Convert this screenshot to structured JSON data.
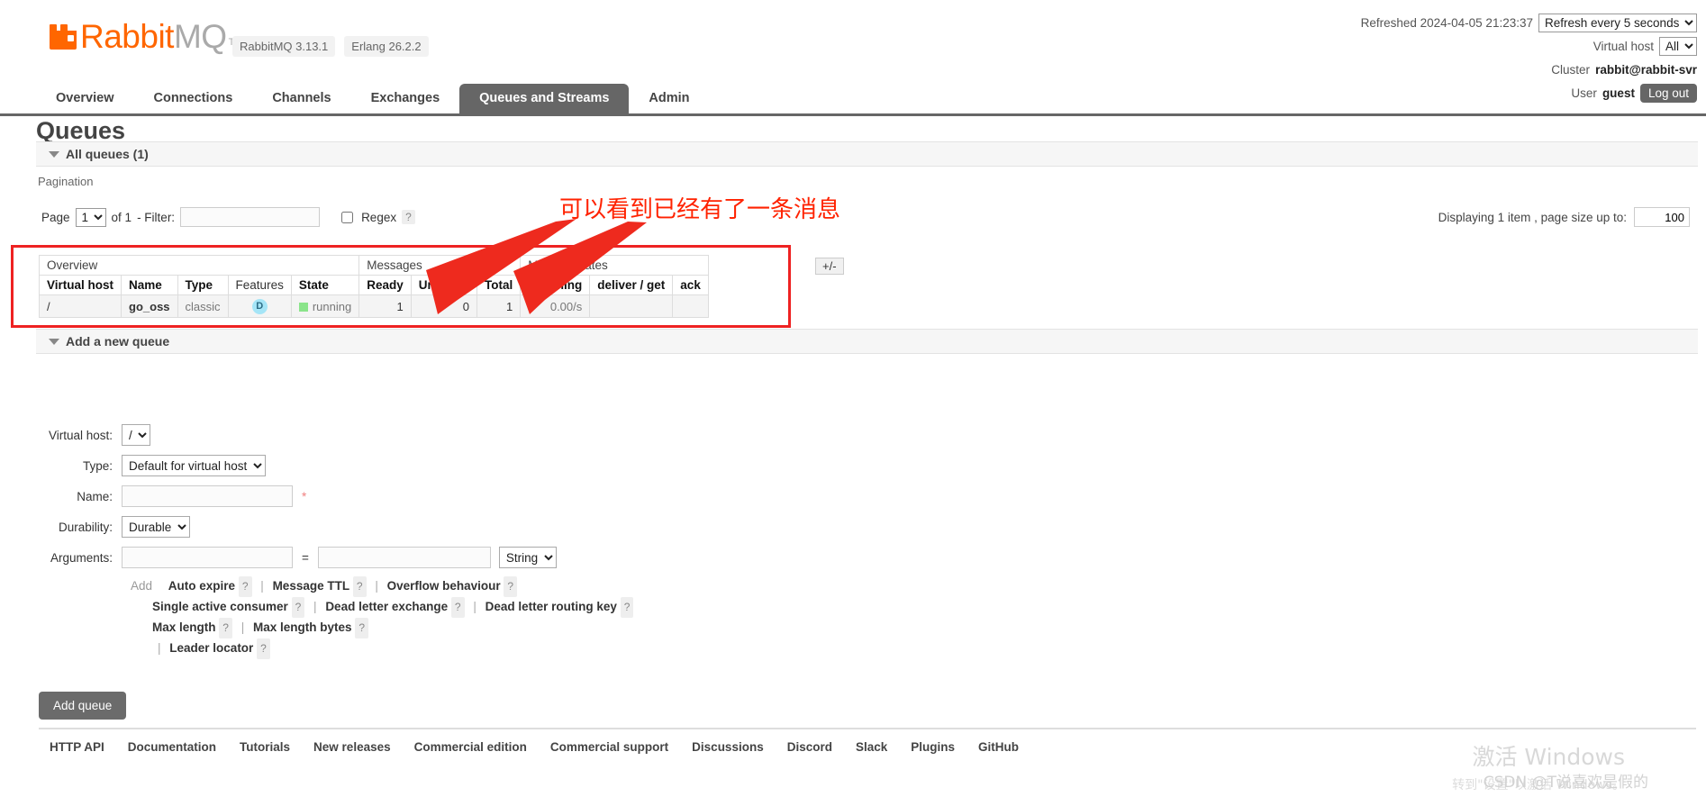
{
  "brand": {
    "name_primary": "Rabbit",
    "name_secondary": "MQ",
    "tm": "TM",
    "version_pill": "RabbitMQ 3.13.1",
    "erlang_pill": "Erlang 26.2.2"
  },
  "topright": {
    "refreshed_label": "Refreshed 2024-04-05 21:23:37",
    "refresh_select": "Refresh every 5 seconds",
    "vhost_label": "Virtual host",
    "vhost_select": "All",
    "cluster_label": "Cluster",
    "cluster_value": "rabbit@rabbit-svr",
    "user_label": "User",
    "user_value": "guest",
    "logout_label": "Log out"
  },
  "nav": {
    "items": [
      {
        "label": "Overview",
        "active": false
      },
      {
        "label": "Connections",
        "active": false
      },
      {
        "label": "Channels",
        "active": false
      },
      {
        "label": "Exchanges",
        "active": false
      },
      {
        "label": "Queues and Streams",
        "active": true
      },
      {
        "label": "Admin",
        "active": false
      }
    ]
  },
  "page": {
    "title": "Queues",
    "all_queues_header": "All queues (1)",
    "pagination_label": "Pagination"
  },
  "pager": {
    "page_label": "Page",
    "page_value": "1",
    "of_label": "of 1",
    "filter_label": "- Filter:",
    "filter_value": "",
    "regex_label": "Regex",
    "help": "?",
    "displaying_label": "Displaying 1 item , page size up to:",
    "page_size_value": "100"
  },
  "queues_table": {
    "group_headers": [
      "Overview",
      "Messages",
      "Message rates"
    ],
    "plusminus": "+/-",
    "columns": [
      {
        "label": "Virtual host",
        "bold": true
      },
      {
        "label": "Name",
        "bold": true
      },
      {
        "label": "Type",
        "bold": true
      },
      {
        "label": "Features",
        "bold": false
      },
      {
        "label": "State",
        "bold": true
      },
      {
        "label": "Ready",
        "bold": true
      },
      {
        "label": "Unacked",
        "bold": true
      },
      {
        "label": "Total",
        "bold": true
      },
      {
        "label": "incoming",
        "bold": true
      },
      {
        "label": "deliver / get",
        "bold": true
      },
      {
        "label": "ack",
        "bold": true
      }
    ],
    "rows": [
      {
        "vhost": "/",
        "name": "go_oss",
        "type": "classic",
        "features": "D",
        "state": "running",
        "ready": "1",
        "unacked": "0",
        "total": "1",
        "incoming": "0.00/s",
        "deliver_get": "",
        "ack": ""
      }
    ]
  },
  "annotation": {
    "text": "可以看到已经有了一条消息",
    "color": "#ff2200"
  },
  "add_queue": {
    "section_header": "Add a new queue",
    "vhost_label": "Virtual host:",
    "vhost_value": "/",
    "type_label": "Type:",
    "type_value": "Default for virtual host",
    "name_label": "Name:",
    "name_value": "",
    "name_required": "*",
    "durability_label": "Durability:",
    "durability_value": "Durable",
    "arguments_label": "Arguments:",
    "arg_key": "",
    "arg_eq": "=",
    "arg_value": "",
    "arg_type": "String",
    "add_label": "Add",
    "arg_presets": [
      "Auto expire",
      "Message TTL",
      "Overflow behaviour",
      "Single active consumer",
      "Dead letter exchange",
      "Dead letter routing key",
      "Max length",
      "Max length bytes",
      "Leader locator"
    ],
    "help": "?",
    "submit_label": "Add queue"
  },
  "footer": {
    "links": [
      "HTTP API",
      "Documentation",
      "Tutorials",
      "New releases",
      "Commercial edition",
      "Commercial support",
      "Discussions",
      "Discord",
      "Slack",
      "Plugins",
      "GitHub"
    ]
  },
  "watermark": {
    "windows_title": "激活 Windows",
    "windows_sub": "转到\"设置\"以激活 Windows。",
    "csdn": "CSDN @T说喜欢是假的"
  }
}
